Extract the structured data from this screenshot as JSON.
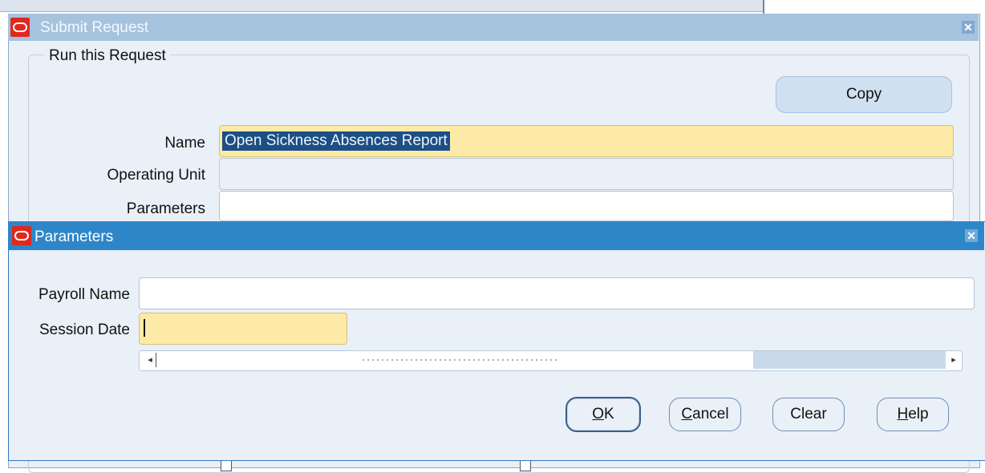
{
  "submit_request": {
    "title": "Submit Request",
    "group_legend": "Run this Request",
    "copy_button": "Copy",
    "name_label": "Name",
    "name_value": "Open Sickness Absences Report",
    "operating_unit_label": "Operating Unit",
    "parameters_label": "Parameters",
    "close_glyph": "✕"
  },
  "parameters_dialog": {
    "title": "Parameters",
    "payroll_name_label": "Payroll Name",
    "payroll_name_value": "",
    "session_date_label": "Session Date",
    "session_date_value": "",
    "close_glyph": "✕",
    "buttons": {
      "ok_mnemonic": "O",
      "ok_rest": "K",
      "cancel_mnemonic": "C",
      "cancel_rest": "ancel",
      "clear": "Clear",
      "help_mnemonic": "H",
      "help_rest": "elp"
    }
  },
  "icons": {
    "oracle_logo": "oracle-o-logo-icon",
    "scroll_left": "◂",
    "scroll_right": "▸"
  },
  "colors": {
    "title_active": "#2e86c8",
    "title_inactive": "#a6c3de",
    "required_field": "#fdeaa7",
    "window_bg": "#eaf0f7"
  }
}
